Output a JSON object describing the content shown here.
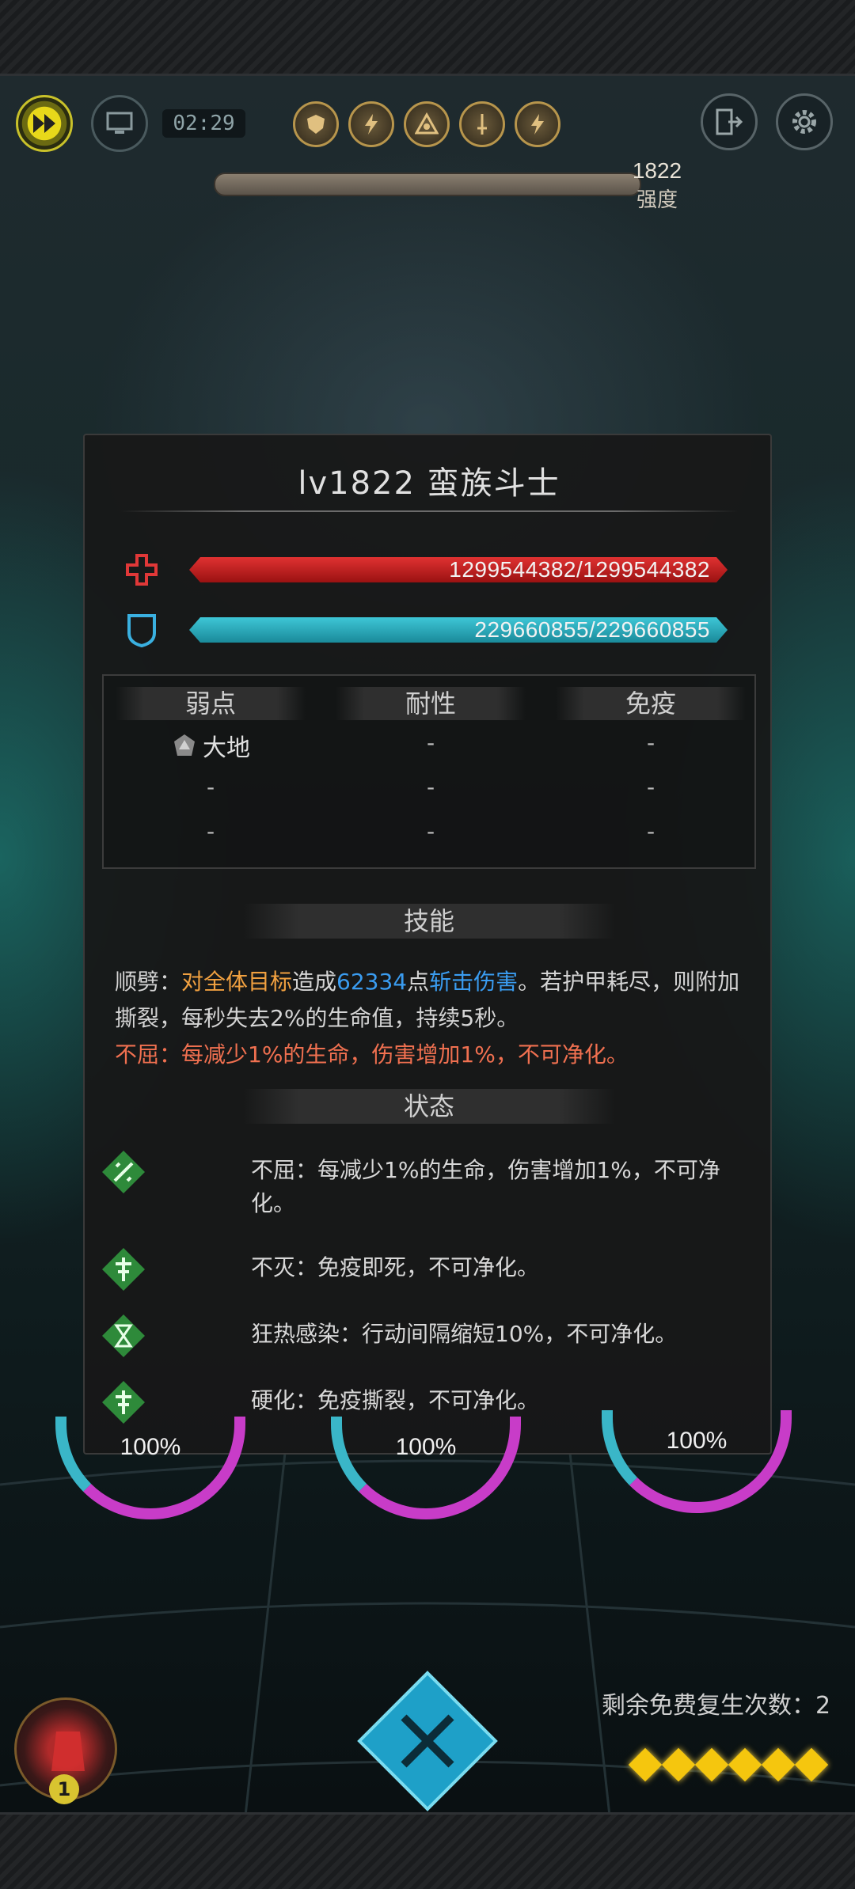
{
  "hud": {
    "timer": "02:29",
    "power_value": "1822",
    "power_label": "强度",
    "buff_icons": [
      "shield-buff-icon",
      "lightning-buff-icon",
      "eye-buff-icon",
      "sword-buff-icon",
      "lightning-buff-icon"
    ]
  },
  "enemy": {
    "title": "lv1822  蛮族斗士",
    "hp_text": "1299544382/1299544382",
    "hp_fraction": 1.0,
    "shield_text": "229660855/229660855",
    "shield_fraction": 1.0
  },
  "resistances": {
    "headers": [
      "弱点",
      "耐性",
      "免疫"
    ],
    "weakness_first": "大地",
    "dash": "-"
  },
  "skills": {
    "header": "技能",
    "skill1_name": "顺劈：",
    "skill1_part1": "对全体目标",
    "skill1_part2": "造成",
    "skill1_value": "62334",
    "skill1_part3": "点",
    "skill1_damage_type": "斩击伤害",
    "skill1_part4": "。若护甲耗尽，则附加撕裂，每秒失去2%的生命值，持续5秒。",
    "skill2": "不屈：每减少1%的生命，伤害增加1%，不可净化。"
  },
  "status": {
    "header": "状态",
    "items": [
      {
        "icon": "sword-cross-status-icon",
        "text": "不屈：每减少1%的生命，伤害增加1%，不可净化。"
      },
      {
        "icon": "ankh-status-icon",
        "text": "不灭：免疫即死，不可净化。"
      },
      {
        "icon": "hourglass-status-icon",
        "text": "狂热感染：行动间隔缩短10%，不可净化。"
      },
      {
        "icon": "ankh-status-icon",
        "text": "硬化：免疫撕裂，不可净化。"
      }
    ]
  },
  "units": [
    {
      "pct": "100%"
    },
    {
      "pct": "100%"
    },
    {
      "pct": "100%"
    }
  ],
  "bottom": {
    "respawn_text": "剩余免费复生次数：2",
    "potion_count": "1",
    "energy_pips": 6
  },
  "colors": {
    "hp": "#d02828",
    "shield": "#2eb4c6",
    "accent_orange": "#f0a040",
    "accent_blue": "#3a9cf0",
    "status_green": "#2e8a3a"
  }
}
